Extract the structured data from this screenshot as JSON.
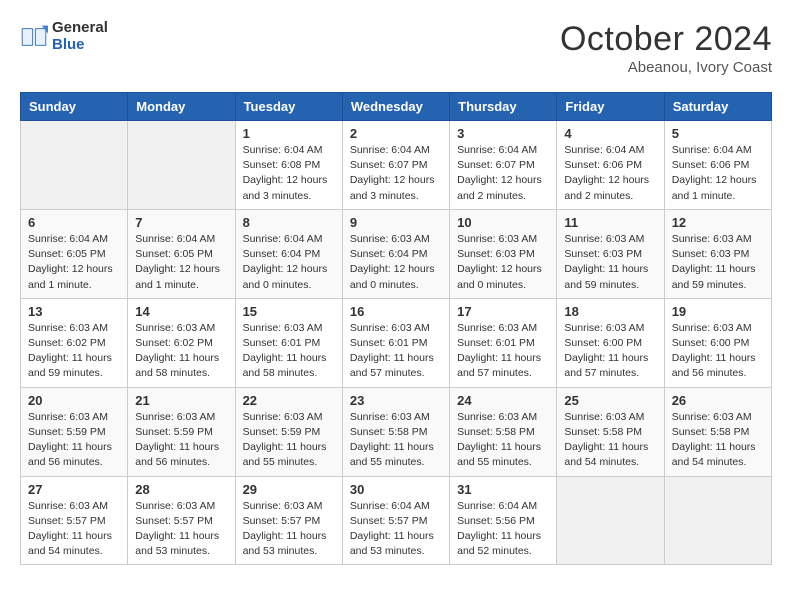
{
  "header": {
    "logo_general": "General",
    "logo_blue": "Blue",
    "title": "October 2024",
    "subtitle": "Abeanou, Ivory Coast"
  },
  "days_of_week": [
    "Sunday",
    "Monday",
    "Tuesday",
    "Wednesday",
    "Thursday",
    "Friday",
    "Saturday"
  ],
  "weeks": [
    [
      {
        "day": "",
        "info": ""
      },
      {
        "day": "",
        "info": ""
      },
      {
        "day": "1",
        "info": "Sunrise: 6:04 AM\nSunset: 6:08 PM\nDaylight: 12 hours\nand 3 minutes."
      },
      {
        "day": "2",
        "info": "Sunrise: 6:04 AM\nSunset: 6:07 PM\nDaylight: 12 hours\nand 3 minutes."
      },
      {
        "day": "3",
        "info": "Sunrise: 6:04 AM\nSunset: 6:07 PM\nDaylight: 12 hours\nand 2 minutes."
      },
      {
        "day": "4",
        "info": "Sunrise: 6:04 AM\nSunset: 6:06 PM\nDaylight: 12 hours\nand 2 minutes."
      },
      {
        "day": "5",
        "info": "Sunrise: 6:04 AM\nSunset: 6:06 PM\nDaylight: 12 hours\nand 1 minute."
      }
    ],
    [
      {
        "day": "6",
        "info": "Sunrise: 6:04 AM\nSunset: 6:05 PM\nDaylight: 12 hours\nand 1 minute."
      },
      {
        "day": "7",
        "info": "Sunrise: 6:04 AM\nSunset: 6:05 PM\nDaylight: 12 hours\nand 1 minute."
      },
      {
        "day": "8",
        "info": "Sunrise: 6:04 AM\nSunset: 6:04 PM\nDaylight: 12 hours\nand 0 minutes."
      },
      {
        "day": "9",
        "info": "Sunrise: 6:03 AM\nSunset: 6:04 PM\nDaylight: 12 hours\nand 0 minutes."
      },
      {
        "day": "10",
        "info": "Sunrise: 6:03 AM\nSunset: 6:03 PM\nDaylight: 12 hours\nand 0 minutes."
      },
      {
        "day": "11",
        "info": "Sunrise: 6:03 AM\nSunset: 6:03 PM\nDaylight: 11 hours\nand 59 minutes."
      },
      {
        "day": "12",
        "info": "Sunrise: 6:03 AM\nSunset: 6:03 PM\nDaylight: 11 hours\nand 59 minutes."
      }
    ],
    [
      {
        "day": "13",
        "info": "Sunrise: 6:03 AM\nSunset: 6:02 PM\nDaylight: 11 hours\nand 59 minutes."
      },
      {
        "day": "14",
        "info": "Sunrise: 6:03 AM\nSunset: 6:02 PM\nDaylight: 11 hours\nand 58 minutes."
      },
      {
        "day": "15",
        "info": "Sunrise: 6:03 AM\nSunset: 6:01 PM\nDaylight: 11 hours\nand 58 minutes."
      },
      {
        "day": "16",
        "info": "Sunrise: 6:03 AM\nSunset: 6:01 PM\nDaylight: 11 hours\nand 57 minutes."
      },
      {
        "day": "17",
        "info": "Sunrise: 6:03 AM\nSunset: 6:01 PM\nDaylight: 11 hours\nand 57 minutes."
      },
      {
        "day": "18",
        "info": "Sunrise: 6:03 AM\nSunset: 6:00 PM\nDaylight: 11 hours\nand 57 minutes."
      },
      {
        "day": "19",
        "info": "Sunrise: 6:03 AM\nSunset: 6:00 PM\nDaylight: 11 hours\nand 56 minutes."
      }
    ],
    [
      {
        "day": "20",
        "info": "Sunrise: 6:03 AM\nSunset: 5:59 PM\nDaylight: 11 hours\nand 56 minutes."
      },
      {
        "day": "21",
        "info": "Sunrise: 6:03 AM\nSunset: 5:59 PM\nDaylight: 11 hours\nand 56 minutes."
      },
      {
        "day": "22",
        "info": "Sunrise: 6:03 AM\nSunset: 5:59 PM\nDaylight: 11 hours\nand 55 minutes."
      },
      {
        "day": "23",
        "info": "Sunrise: 6:03 AM\nSunset: 5:58 PM\nDaylight: 11 hours\nand 55 minutes."
      },
      {
        "day": "24",
        "info": "Sunrise: 6:03 AM\nSunset: 5:58 PM\nDaylight: 11 hours\nand 55 minutes."
      },
      {
        "day": "25",
        "info": "Sunrise: 6:03 AM\nSunset: 5:58 PM\nDaylight: 11 hours\nand 54 minutes."
      },
      {
        "day": "26",
        "info": "Sunrise: 6:03 AM\nSunset: 5:58 PM\nDaylight: 11 hours\nand 54 minutes."
      }
    ],
    [
      {
        "day": "27",
        "info": "Sunrise: 6:03 AM\nSunset: 5:57 PM\nDaylight: 11 hours\nand 54 minutes."
      },
      {
        "day": "28",
        "info": "Sunrise: 6:03 AM\nSunset: 5:57 PM\nDaylight: 11 hours\nand 53 minutes."
      },
      {
        "day": "29",
        "info": "Sunrise: 6:03 AM\nSunset: 5:57 PM\nDaylight: 11 hours\nand 53 minutes."
      },
      {
        "day": "30",
        "info": "Sunrise: 6:04 AM\nSunset: 5:57 PM\nDaylight: 11 hours\nand 53 minutes."
      },
      {
        "day": "31",
        "info": "Sunrise: 6:04 AM\nSunset: 5:56 PM\nDaylight: 11 hours\nand 52 minutes."
      },
      {
        "day": "",
        "info": ""
      },
      {
        "day": "",
        "info": ""
      }
    ]
  ]
}
